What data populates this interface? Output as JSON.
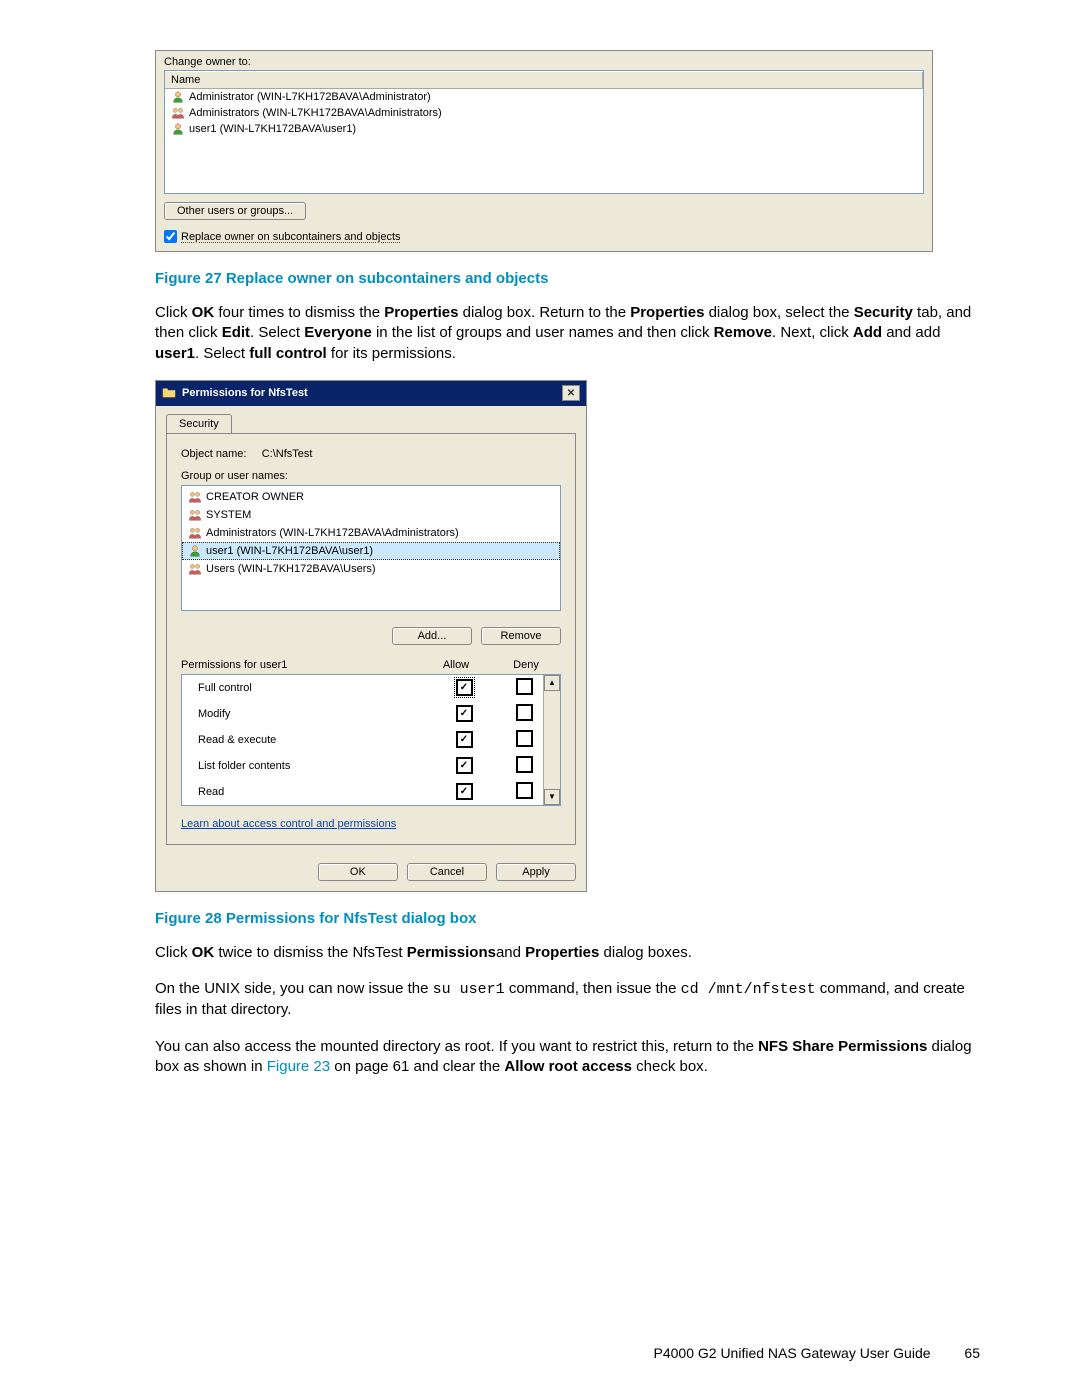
{
  "fig27": {
    "change_owner_label": "Change owner to:",
    "name_header": "Name",
    "owners": [
      {
        "text": "Administrator (WIN-L7KH172BAVA\\Administrator)",
        "type": "user"
      },
      {
        "text": "Administrators (WIN-L7KH172BAVA\\Administrators)",
        "type": "group"
      },
      {
        "text": "user1 (WIN-L7KH172BAVA\\user1)",
        "type": "user"
      }
    ],
    "other_button": "Other users or groups...",
    "replace_checkbox": "Replace owner on subcontainers and objects",
    "caption": "Figure 27 Replace owner on subcontainers and objects"
  },
  "para1": {
    "pre": "Click ",
    "b1": "OK",
    "t1": " four times to dismiss the ",
    "b2": "Properties",
    "t2": " dialog box. Return to the ",
    "b3": "Properties",
    "t3": " dialog box, select the ",
    "b4": "Security",
    "t4": " tab, and then click ",
    "b5": "Edit",
    "t5": ". Select ",
    "b6": "Everyone",
    "t6": " in the list of groups and user names and then click ",
    "b7": "Remove",
    "t7": ". Next, click ",
    "b8": "Add",
    "t8": " and add ",
    "b9": "user1",
    "t9": ". Select ",
    "b10": "full control",
    "t10": " for its permissions."
  },
  "fig28": {
    "title": "Permissions for NfsTest",
    "tab": "Security",
    "object_label": "Object name:",
    "object_value": "C:\\NfsTest",
    "group_label": "Group or user names:",
    "groups": [
      {
        "text": "CREATOR OWNER",
        "type": "group"
      },
      {
        "text": "SYSTEM",
        "type": "group"
      },
      {
        "text": "Administrators (WIN-L7KH172BAVA\\Administrators)",
        "type": "group"
      },
      {
        "text": "user1 (WIN-L7KH172BAVA\\user1)",
        "type": "user",
        "selected": true
      },
      {
        "text": "Users (WIN-L7KH172BAVA\\Users)",
        "type": "group"
      }
    ],
    "add_button": "Add...",
    "remove_button": "Remove",
    "perms_label": "Permissions for user1",
    "allow_label": "Allow",
    "deny_label": "Deny",
    "perms": [
      {
        "name": "Full control",
        "allow": true,
        "deny": false,
        "focus": true
      },
      {
        "name": "Modify",
        "allow": true,
        "deny": false
      },
      {
        "name": "Read & execute",
        "allow": true,
        "deny": false
      },
      {
        "name": "List folder contents",
        "allow": true,
        "deny": false
      },
      {
        "name": "Read",
        "allow": true,
        "deny": false
      }
    ],
    "learn_link": "Learn about access control and permissions",
    "ok_button": "OK",
    "cancel_button": "Cancel",
    "apply_button": "Apply",
    "caption": "Figure 28 Permissions for NfsTest dialog box"
  },
  "para2": {
    "pre": "Click ",
    "b1": "OK",
    "t1": " twice to dismiss the NfsTest ",
    "b2": "Permissions",
    "t2": "and ",
    "b3": "Properties",
    "t3": " dialog boxes."
  },
  "para3": {
    "t1": "On the UNIX side, you can now issue the ",
    "m1": "su user1",
    "t2": " command, then issue the ",
    "m2": "cd /mnt/nfstest",
    "t3": " command, and create files in that directory."
  },
  "para4": {
    "t1": "You can also access the mounted directory as root. If you want to restrict this, return to the ",
    "b1": "NFS Share Permissions",
    "t2": " dialog box as shown in ",
    "link": "Figure 23",
    "t3": " on page 61 and clear the ",
    "b2": "Allow root access",
    "t4": " check box."
  },
  "footer": {
    "doc": "P4000 G2 Unified NAS Gateway User Guide",
    "page": "65"
  }
}
